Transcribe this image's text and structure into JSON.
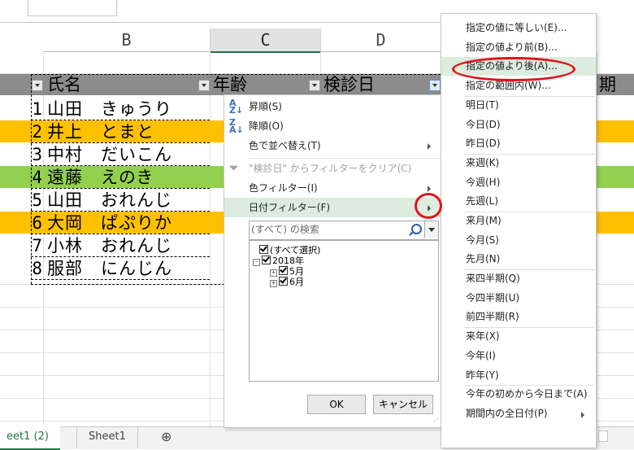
{
  "sheet": {
    "columns": [
      {
        "id": "B",
        "selected": false
      },
      {
        "id": "C",
        "selected": true
      },
      {
        "id": "D",
        "selected": false
      }
    ],
    "headers": {
      "name": "氏名",
      "age": "年齢",
      "checkup_date": "検診日",
      "partial_next": "期"
    },
    "rows": [
      {
        "num": "1",
        "text": "山田　きゅうり",
        "fill": ""
      },
      {
        "num": "2",
        "text": "井上　とまと",
        "fill": "#ffc000"
      },
      {
        "num": "3",
        "text": "中村　だいこん",
        "fill": ""
      },
      {
        "num": "4",
        "text": "遠藤　えのき",
        "fill": "#92d050"
      },
      {
        "num": "5",
        "text": "山田　おれんじ",
        "fill": ""
      },
      {
        "num": "6",
        "text": "大岡　ぱぷりか",
        "fill": "#ffc000"
      },
      {
        "num": "7",
        "text": "小林　おれんじ",
        "fill": ""
      },
      {
        "num": "8",
        "text": "服部　にんじん",
        "fill": ""
      }
    ],
    "tabs": [
      {
        "label": "eet1 (2)",
        "active": true
      },
      {
        "label": "Sheet1",
        "active": false
      },
      {
        "label": "⊕",
        "active": false
      }
    ]
  },
  "filter_menu": {
    "items": [
      {
        "label": "昇順(S)",
        "icon": "sort-ascending-icon",
        "disabled": false
      },
      {
        "label": "降順(O)",
        "icon": "sort-descending-icon",
        "disabled": false
      },
      {
        "label": "色で並べ替え(T)",
        "icon": "",
        "disabled": false,
        "submenu": true
      },
      {
        "label": "\"検診日\" からフィルターをクリア(C)",
        "icon": "clear-filter-icon",
        "disabled": true
      },
      {
        "label": "色フィルター(I)",
        "icon": "",
        "disabled": false,
        "submenu": true
      },
      {
        "label": "日付フィルター(F)",
        "icon": "",
        "disabled": false,
        "submenu": true,
        "highlighted": true
      }
    ],
    "search_placeholder": "(すべて) の検索",
    "tree": [
      {
        "label": "(すべて選択)",
        "checked": true
      },
      {
        "label": "2018年",
        "checked": true,
        "expander": "-"
      },
      {
        "label": "5月",
        "checked": true,
        "expander": "+"
      },
      {
        "label": "6月",
        "checked": true,
        "expander": "+"
      }
    ],
    "ok_label": "OK",
    "cancel_label": "キャンセル"
  },
  "date_submenu": {
    "items": [
      {
        "label": "指定の値に等しい(E)..."
      },
      {
        "label": "指定の値より前(B)..."
      },
      {
        "label": "指定の値より後(A)...",
        "highlighted": true
      },
      {
        "label": "指定の範囲内(W)..."
      },
      {
        "label": "明日(T)"
      },
      {
        "label": "今日(D)"
      },
      {
        "label": "昨日(D)"
      },
      {
        "label": "来週(K)"
      },
      {
        "label": "今週(H)"
      },
      {
        "label": "先週(L)"
      },
      {
        "label": "来月(M)"
      },
      {
        "label": "今月(S)"
      },
      {
        "label": "先月(N)"
      },
      {
        "label": "来四半期(Q)"
      },
      {
        "label": "今四半期(U)"
      },
      {
        "label": "前四半期(R)"
      },
      {
        "label": "来年(X)"
      },
      {
        "label": "今年(I)"
      },
      {
        "label": "昨年(Y)"
      },
      {
        "label": "今年の初めから今日まで(A)"
      },
      {
        "label": "期間内の全日付(P)",
        "submenu": true
      }
    ]
  },
  "colors": {
    "accent": "#217346",
    "orange_fill": "#ffc000",
    "green_fill": "#92d050",
    "header_fill": "#8c8c8c",
    "annotation": "#e0141b"
  }
}
